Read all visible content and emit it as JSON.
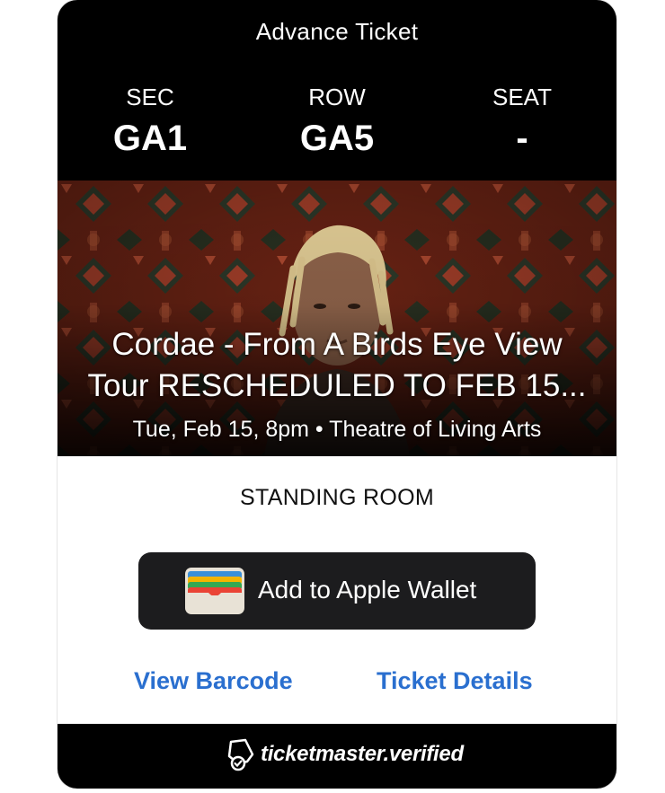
{
  "ticket": {
    "type_label": "Advance Ticket",
    "sec_label": "SEC",
    "sec_value": "GA1",
    "row_label": "ROW",
    "row_value": "GA5",
    "seat_label": "SEAT",
    "seat_value": "-"
  },
  "event": {
    "title_line1": "Cordae - From A Birds Eye View",
    "title_line2": "Tour RESCHEDULED TO FEB 15...",
    "meta": "Tue, Feb 15, 8pm • Theatre of Living Arts"
  },
  "section_name": "STANDING ROOM",
  "wallet": {
    "label": "Add to Apple Wallet",
    "icon": "apple-wallet-icon"
  },
  "links": {
    "barcode": "View Barcode",
    "details": "Ticket Details"
  },
  "footer": {
    "brand": "ticketmaster.verified",
    "icon": "ticketmaster-verified-icon"
  },
  "colors": {
    "header_bg": "#000000",
    "link": "#2a6fcf",
    "wallet_button_bg": "#1c1c1e"
  }
}
